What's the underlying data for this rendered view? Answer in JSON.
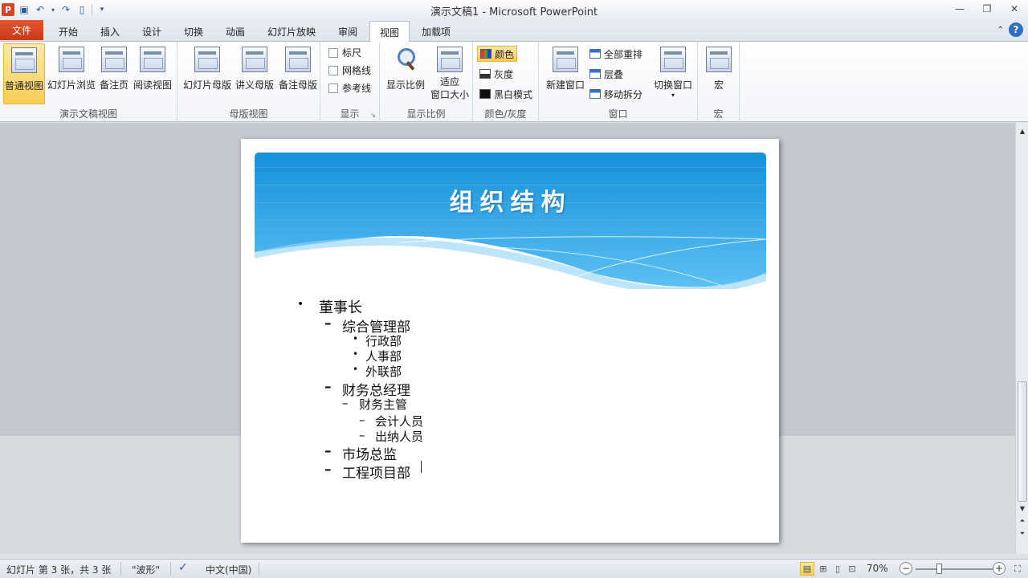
{
  "window": {
    "title": "演示文稿1 - Microsoft PowerPoint"
  },
  "qat": {
    "app_icon": "P"
  },
  "tabs": [
    {
      "label": "文件"
    },
    {
      "label": "开始"
    },
    {
      "label": "插入"
    },
    {
      "label": "设计"
    },
    {
      "label": "切换"
    },
    {
      "label": "动画"
    },
    {
      "label": "幻灯片放映"
    },
    {
      "label": "审阅"
    },
    {
      "label": "视图"
    },
    {
      "label": "加载项"
    }
  ],
  "ribbon": {
    "presentation_views": {
      "label": "演示文稿视图",
      "normal": "普通视图",
      "sorter": "幻灯片浏览",
      "notes": "备注页",
      "reading": "阅读视图"
    },
    "master_views": {
      "label": "母版视图",
      "slide_master": "幻灯片母版",
      "handout_master": "讲义母版",
      "notes_master": "备注母版"
    },
    "show": {
      "label": "显示",
      "ruler": "标尺",
      "gridlines": "网格线",
      "guides": "参考线"
    },
    "zoom": {
      "label": "显示比例",
      "zoom": "显示比例",
      "fit_line1": "适应",
      "fit_line2": "窗口大小"
    },
    "color": {
      "label": "颜色/灰度",
      "color": "颜色",
      "grayscale": "灰度",
      "bw": "黑白模式"
    },
    "window": {
      "label": "窗口",
      "new_window": "新建窗口",
      "arrange_all": "全部重排",
      "cascade": "层叠",
      "move_split": "移动拆分",
      "switch": "切换窗口"
    },
    "macros": {
      "label": "宏",
      "macros": "宏"
    }
  },
  "slide": {
    "title": "组织结构",
    "outline": [
      {
        "bullet": "•",
        "text": "董事长"
      },
      {
        "bullet": "–",
        "text": "综合管理部"
      },
      {
        "bullet": "•",
        "text": "行政部"
      },
      {
        "bullet": "•",
        "text": "人事部"
      },
      {
        "bullet": "•",
        "text": "外联部"
      },
      {
        "bullet": "–",
        "text": "财务总经理"
      },
      {
        "bullet": "–",
        "text": "财务主管"
      },
      {
        "bullet": "–",
        "text": "会计人员"
      },
      {
        "bullet": "–",
        "text": "出纳人员"
      },
      {
        "bullet": "–",
        "text": "市场总监"
      },
      {
        "bullet": "–",
        "text": "工程项目部"
      }
    ]
  },
  "status": {
    "slide_info": "幻灯片 第 3 张，共 3 张",
    "theme": "\"波形\"",
    "language": "中文(中国)",
    "zoom": "70%"
  },
  "colors": {
    "accent": "#c9391a",
    "header_blue": "#1e9be0"
  }
}
